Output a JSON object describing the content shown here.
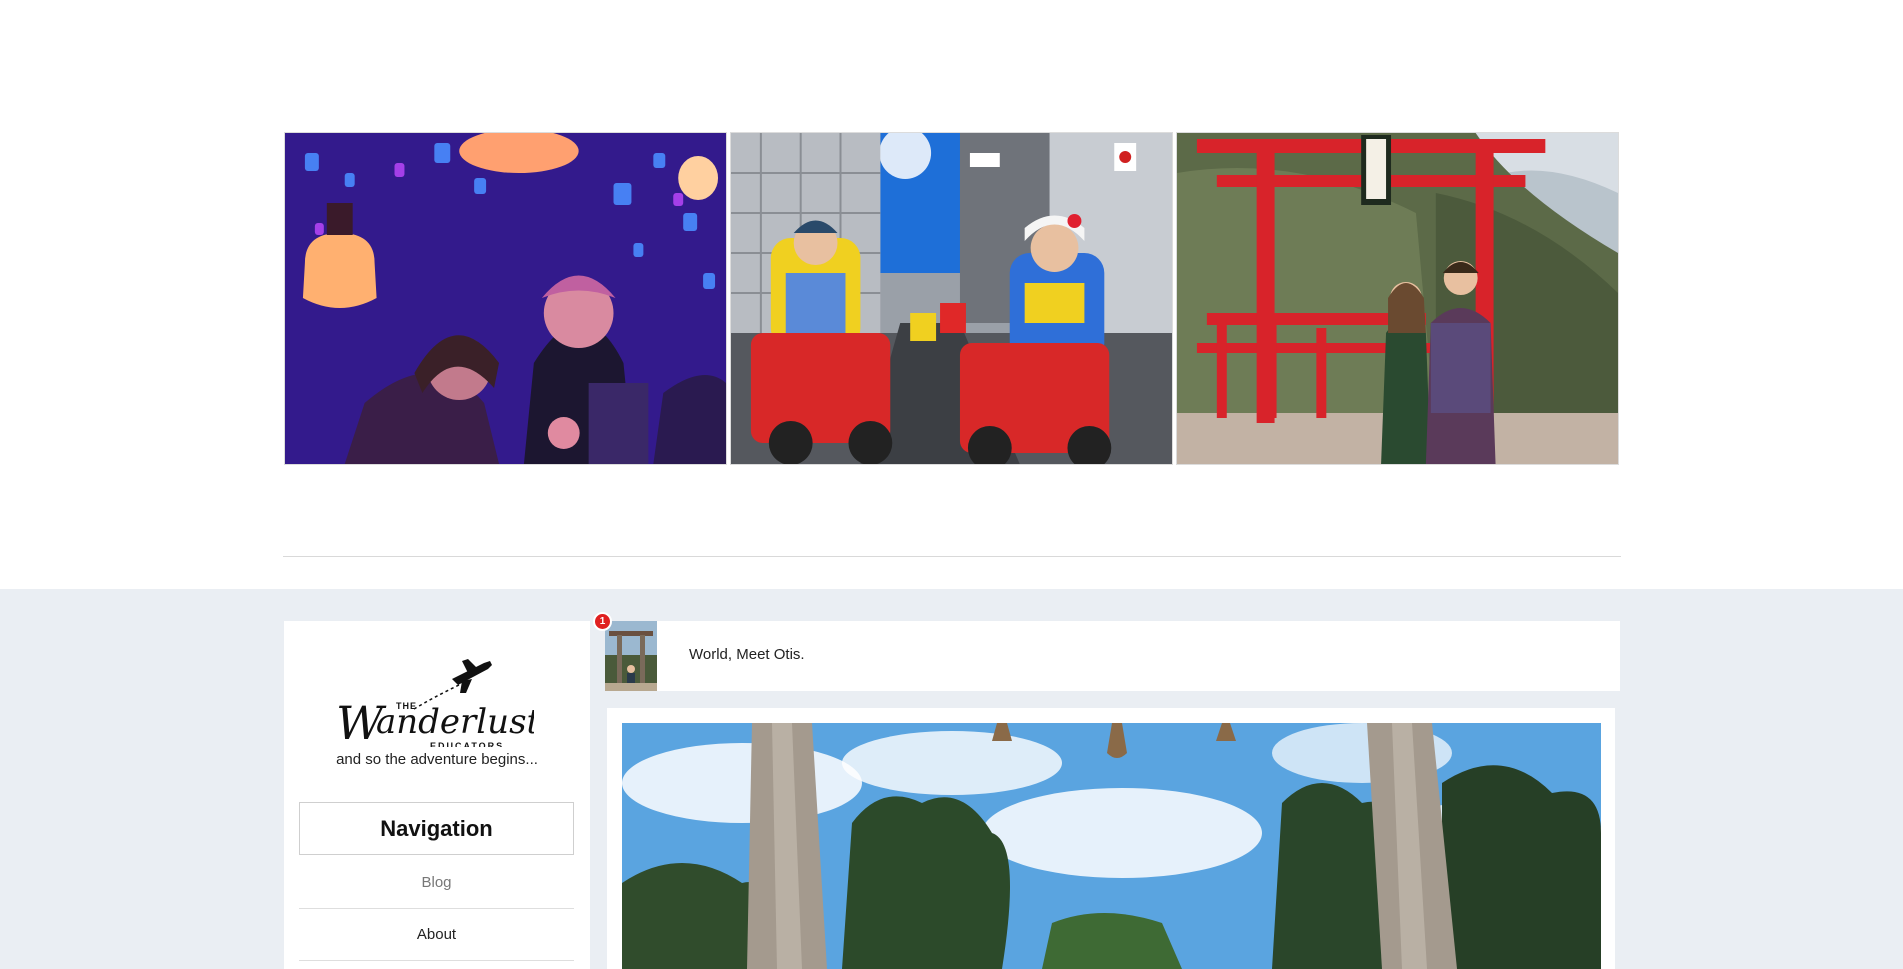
{
  "gallery": {
    "photos": [
      {
        "alt": "couple in lantern room",
        "label": "lantern-room-photo"
      },
      {
        "alt": "go-kart street tour",
        "label": "go-kart-photo"
      },
      {
        "alt": "couple at red torii gates",
        "label": "torii-photo"
      }
    ]
  },
  "sidebar": {
    "logo": {
      "the": "THE",
      "word": "Wanderlust",
      "educators": "EDUCATORS"
    },
    "tagline": "and so the adventure begins...",
    "nav_heading": "Navigation",
    "items": [
      {
        "label": "Blog"
      },
      {
        "label": "About"
      }
    ]
  },
  "post": {
    "badge_count": "1",
    "title": "World, Meet Otis."
  },
  "colors": {
    "lower_bg": "#eaeef3",
    "badge": "#e02020"
  }
}
